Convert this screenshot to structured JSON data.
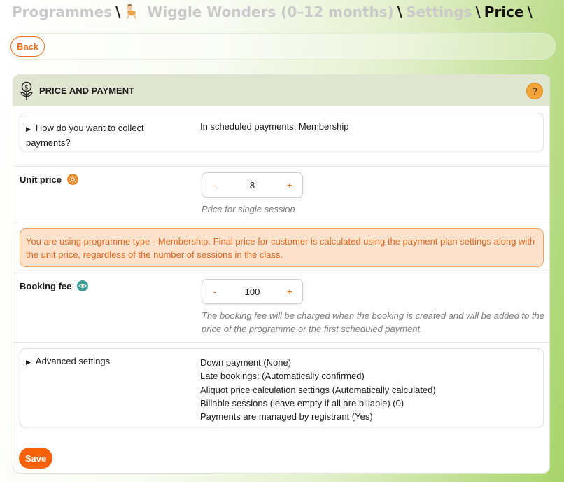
{
  "breadcrumb": {
    "programmes": "Programmes",
    "programme": "Wiggle Wonders (0–12 months)",
    "settings": "Settings",
    "current": "Price",
    "separator": "\\"
  },
  "back_label": "Back",
  "section": {
    "title": "PRICE AND PAYMENT",
    "help": "?"
  },
  "collect": {
    "label": "How do you want to collect payments?",
    "value": "In scheduled payments, Membership"
  },
  "unit_price": {
    "label": "Unit price",
    "minus": "-",
    "value": "8",
    "plus": "+",
    "hint": "Price for single session"
  },
  "notice": "You are using programme type - Membership. Final price for customer is calculated using the payment plan settings along with the unit price, regardless of the number of sessions in the class.",
  "booking_fee": {
    "label": "Booking fee",
    "minus": "-",
    "value": "100",
    "plus": "+",
    "hint": "The booking fee will be charged when the booking is created and will be added to the price of the programme or the first scheduled payment."
  },
  "advanced": {
    "label": "Advanced settings",
    "items": [
      "Down payment (None)",
      "Late bookings: (Automatically confirmed)",
      "Aliquot price calculation settings (Automatically calculated)",
      "Billable sessions (leave empty if all are billable) (0)",
      "Payments are managed by registrant (Yes)"
    ]
  },
  "save_label": "Save",
  "colors": {
    "accent": "#f26a16",
    "notice_bg": "#fde2cd",
    "header_bg": "#dfe5d0",
    "help": "#f3a53a",
    "info_teal": "#3c9c93"
  },
  "icons": {
    "section": "money-plant-icon",
    "help": "question-icon",
    "unit_price_info": "sun-info-icon",
    "booking_fee_info": "eye-icon",
    "programme": "baby-crawling-icon",
    "disclosure": "triangle-right-icon"
  }
}
